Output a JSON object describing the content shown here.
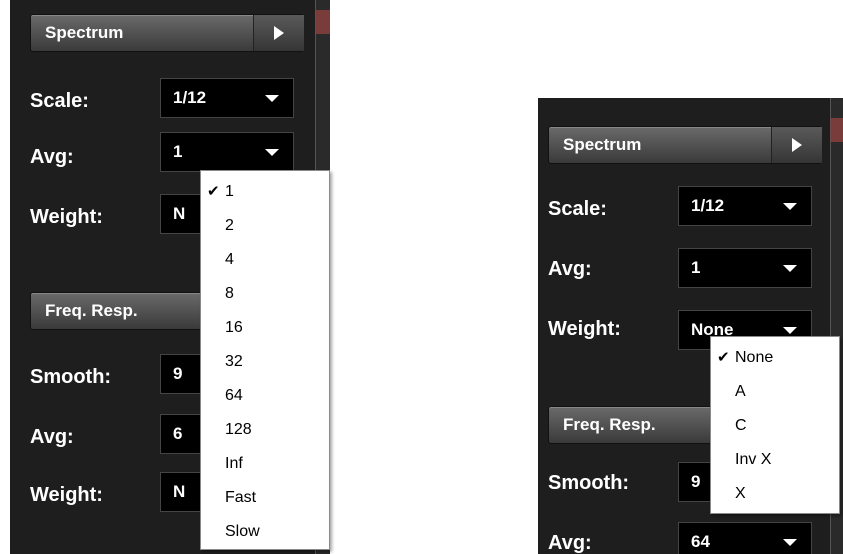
{
  "left_panel": {
    "spectrum": {
      "title": "Spectrum",
      "scale_label": "Scale:",
      "scale_value": "1/12",
      "avg_label": "Avg:",
      "avg_value": "1",
      "weight_label": "Weight:",
      "weight_value_visible": "N"
    },
    "freq_resp": {
      "title": "Freq. Resp.",
      "smooth_label": "Smooth:",
      "smooth_value_visible": "9",
      "avg_label": "Avg:",
      "avg_value_visible": "6",
      "weight_label": "Weight:",
      "weight_value_visible": "N"
    },
    "avg_menu": {
      "selected": "1",
      "check_glyph": "✔",
      "options": [
        "1",
        "2",
        "4",
        "8",
        "16",
        "32",
        "64",
        "128",
        "Inf",
        "Fast",
        "Slow"
      ]
    }
  },
  "right_panel": {
    "spectrum": {
      "title": "Spectrum",
      "scale_label": "Scale:",
      "scale_value": "1/12",
      "avg_label": "Avg:",
      "avg_value": "1",
      "weight_label": "Weight:",
      "weight_value": "None"
    },
    "freq_resp": {
      "title": "Freq. Resp.",
      "smooth_label": "Smooth:",
      "smooth_value_visible": "9",
      "avg_label": "Avg:",
      "avg_value": "64"
    },
    "weight_menu": {
      "selected": "None",
      "check_glyph": "✔",
      "options": [
        "None",
        "A",
        "C",
        "Inv X",
        "X"
      ]
    }
  },
  "colors": {
    "panel_bg": "#1e1e1e",
    "text": "#ffffff",
    "field_bg": "#000000",
    "scroll_knob": "#7a3b3b",
    "menu_bg": "#ffffff"
  }
}
